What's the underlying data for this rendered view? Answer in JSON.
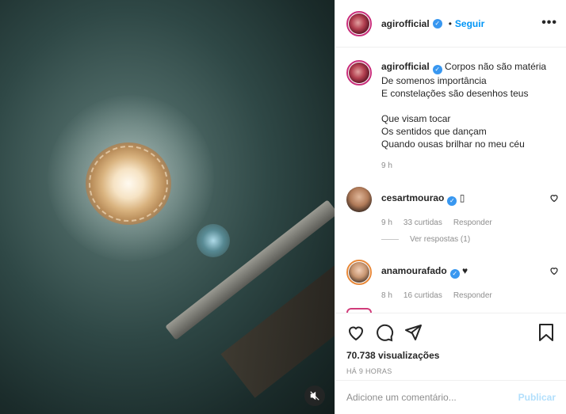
{
  "post": {
    "username": "agirofficial",
    "follow_label": "Seguir",
    "dot": "•",
    "more_label": "•••"
  },
  "caption": {
    "username": "agirofficial",
    "lines": [
      "Corpos não são matéria",
      "De somenos importância",
      "E constelações são desenhos teus",
      "Que visam tocar",
      "Os sentidos que dançam",
      "Quando ousas brilhar no meu céu"
    ],
    "time": "9 h"
  },
  "comments": [
    {
      "username": "cesartmourao",
      "text": "▯",
      "time": "9 h",
      "likes": "33 curtidas",
      "reply_label": "Responder",
      "view_replies": "Ver respostas (1)"
    },
    {
      "username": "anamourafado",
      "text": "♥",
      "time": "8 h",
      "likes": "16 curtidas",
      "reply_label": "Responder"
    }
  ],
  "stats": {
    "views": "70.738 visualizações",
    "posted_ago": "HÁ 9 HORAS"
  },
  "add_comment": {
    "placeholder": "Adicione um comentário...",
    "publish_label": "Publicar"
  },
  "icons": {
    "like": "heart-icon",
    "comment": "comment-icon",
    "share": "share-icon",
    "save": "bookmark-icon",
    "mute": "muted-speaker-icon",
    "verified": "verified-badge-icon"
  },
  "colors": {
    "accent_blue": "#0095f6",
    "verified_blue": "#3897f0",
    "publish_disabled": "#b2dffc",
    "muted_text": "#8e8e8e"
  }
}
